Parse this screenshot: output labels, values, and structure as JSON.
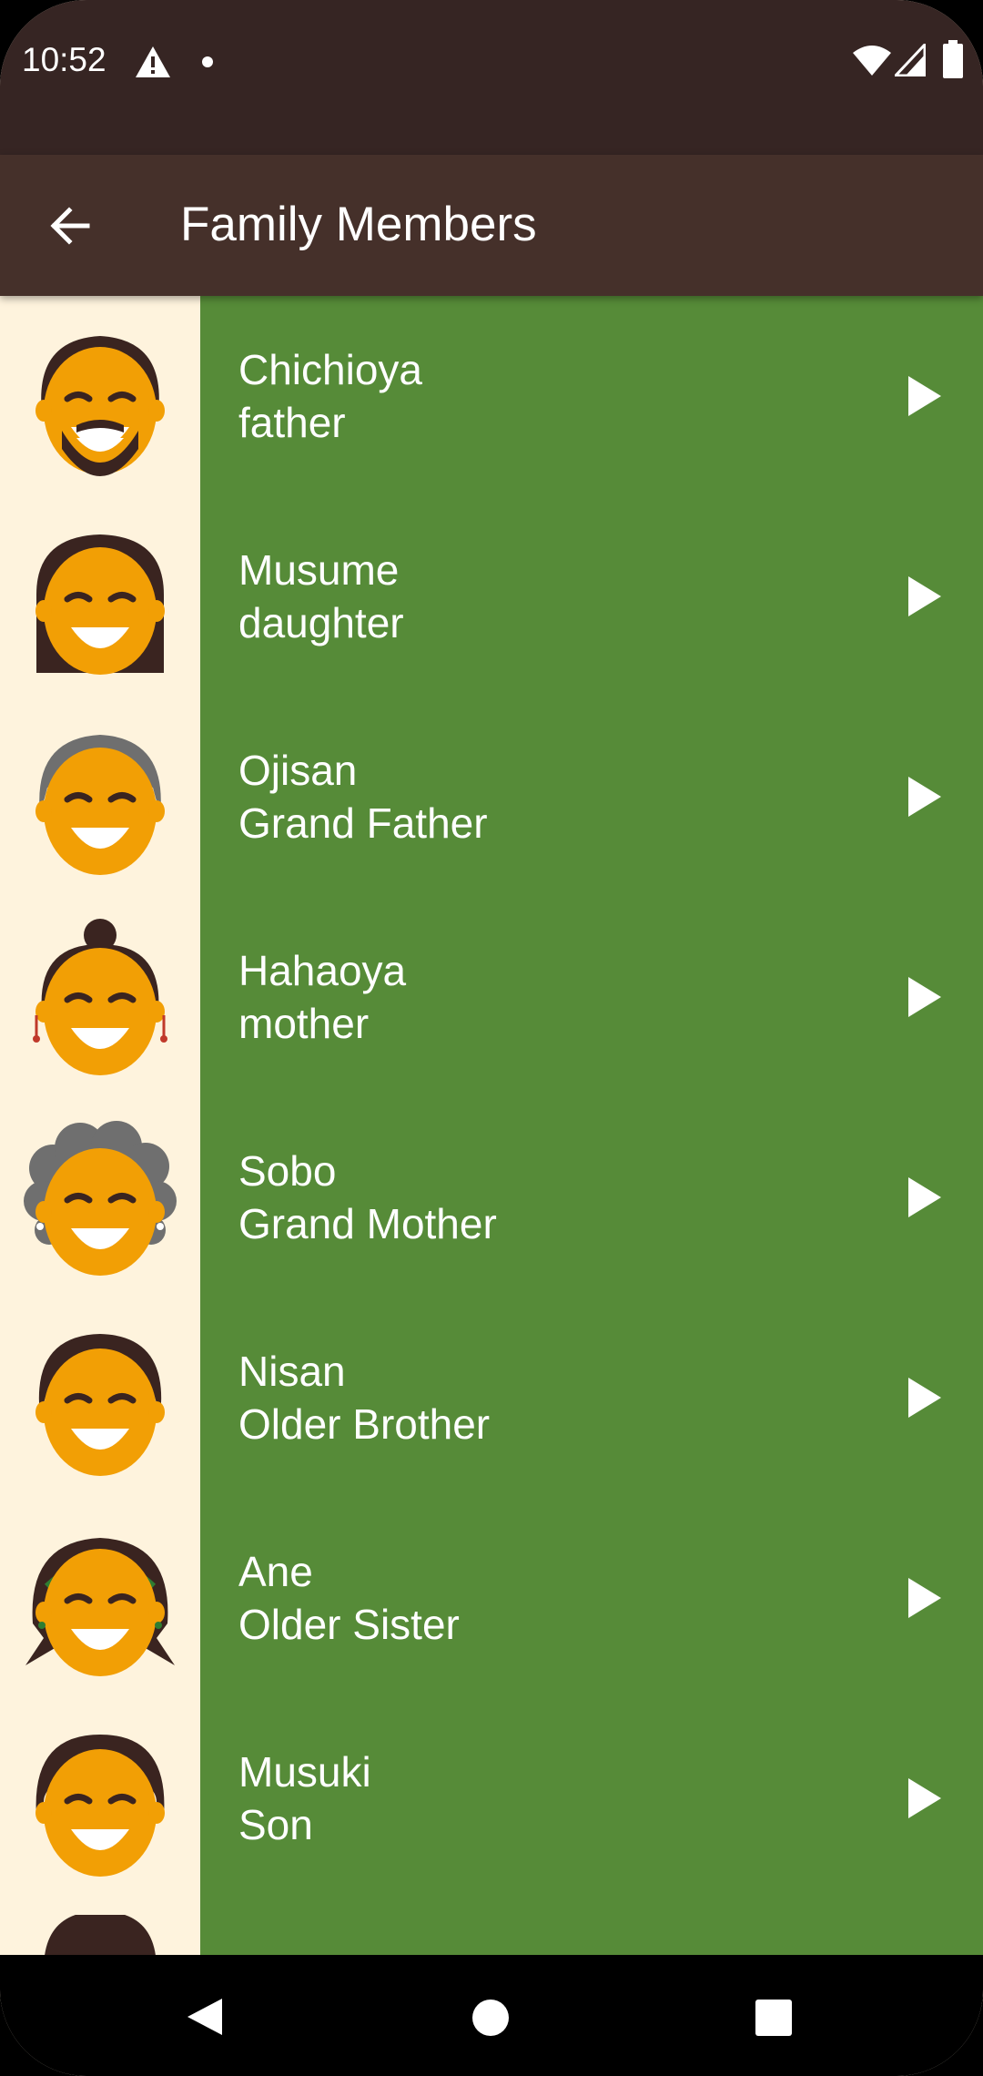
{
  "status_bar": {
    "time": "10:52",
    "icons": [
      "alert-icon",
      "dot-icon",
      "wifi-icon",
      "signal-icon",
      "battery-icon"
    ]
  },
  "app_bar": {
    "title": "Family Members",
    "back_icon": "arrow-back-icon"
  },
  "colors": {
    "status_bar": "#362523",
    "app_bar": "#45302A",
    "list_background": "#568B38",
    "avatar_column": "#FEF3DD",
    "skin": "#F29F05"
  },
  "members": [
    {
      "japanese": "Chichioya",
      "english": "father",
      "avatar": "father-avatar"
    },
    {
      "japanese": "Musume",
      "english": "daughter",
      "avatar": "daughter-avatar"
    },
    {
      "japanese": "Ojisan",
      "english": "Grand Father",
      "avatar": "grandfather-avatar"
    },
    {
      "japanese": "Hahaoya",
      "english": "mother",
      "avatar": "mother-avatar"
    },
    {
      "japanese": "Sobo",
      "english": "Grand Mother",
      "avatar": "grandmother-avatar"
    },
    {
      "japanese": "Nisan",
      "english": "Older Brother",
      "avatar": "older-brother-avatar"
    },
    {
      "japanese": "Ane",
      "english": "Older Sister",
      "avatar": "older-sister-avatar"
    },
    {
      "japanese": "Musuki",
      "english": "Son",
      "avatar": "son-avatar"
    }
  ],
  "nav_bar": {
    "buttons": [
      "back-triangle-icon",
      "home-circle-icon",
      "recents-square-icon"
    ]
  }
}
